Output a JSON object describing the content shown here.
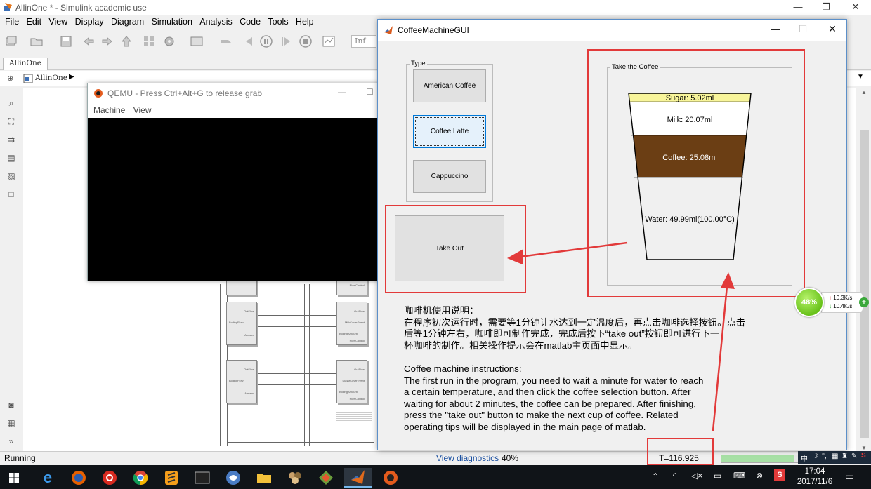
{
  "simulink": {
    "title": "AllinOne * - Simulink academic use",
    "menu": [
      "File",
      "Edit",
      "View",
      "Display",
      "Diagram",
      "Simulation",
      "Analysis",
      "Code",
      "Tools",
      "Help"
    ],
    "toolbar_field": "Inf",
    "tab": "AllinOne",
    "breadcrumb": "AllinOne",
    "status": {
      "state": "Running",
      "diagnostics": "View diagnostics",
      "progress": "40%",
      "time": "T=116.925",
      "progress_fraction": 0.55
    },
    "block_labels": [
      "OutFlow",
      "BoilingFlow",
      "Amount",
      "MilkCoverEvent",
      "FlowControl",
      "BoilingAmount",
      "SugarCoverEvent"
    ]
  },
  "qemu": {
    "title": "QEMU - Press Ctrl+Alt+G to release grab",
    "menu": [
      "Machine",
      "View"
    ]
  },
  "coffee_gui": {
    "title": "CoffeeMachineGUI",
    "type_panel": {
      "legend": "Type",
      "buttons": [
        "American Coffee",
        "Coffee Latte",
        "Cappuccino"
      ],
      "selected": "Coffee Latte"
    },
    "take_out_button": "Take Out",
    "cup_panel": {
      "legend": "Take the Coffee",
      "layers": [
        {
          "label": "Sugar: 5.02ml",
          "color": "#f8f59a",
          "ml": 5.02
        },
        {
          "label": "Milk: 20.07ml",
          "color": "#ffffff",
          "ml": 20.07
        },
        {
          "label": "Coffee: 25.08ml",
          "color": "#6b3e14",
          "ml": 25.08
        },
        {
          "label": "Water: 49.99ml(100.00°C)",
          "color": "#f0f0f0",
          "ml": 49.99
        }
      ]
    },
    "instructions_cn": "咖啡机使用说明：\n在程序初次运行时，需要等1分钟让水达到一定温度后，再点击咖啡选择按钮。点击\n后等1分钟左右，咖啡即可制作完成，完成后按下“take out”按钮即可进行下一\n杯咖啡的制作。相关操作提示会在matlab主页面中显示。",
    "instructions_en": "Coffee machine instructions:\nThe first run in the program, you need to wait a minute for water to reach\na certain temperature, and then click the coffee selection button. After\nwaiting for about 2 minutes, the coffee can be prepared. After finishing,\npress the \"take out\" button to make the next cup of coffee. Related\noperating tips will be displayed in the main page of matlab."
  },
  "net_monitor": {
    "percent": "48%",
    "upload": "10.3K/s",
    "download": "10.4K/s"
  },
  "taskbar": {
    "time": "17:04",
    "date": "2017/11/6",
    "apps": [
      "start-icon",
      "edge-icon",
      "firefox-icon",
      "netease-music-icon",
      "chrome-icon",
      "sublime-icon",
      "terminal-icon",
      "network-app-icon",
      "file-explorer-icon",
      "game-icon",
      "git-icon",
      "matlab-icon",
      "qemu-icon"
    ]
  },
  "colors": {
    "annotation_red": "#e23a3a",
    "selected_blue": "#0078d7",
    "coffee_brown": "#6b3e14",
    "sugar_yellow": "#f8f59a"
  }
}
